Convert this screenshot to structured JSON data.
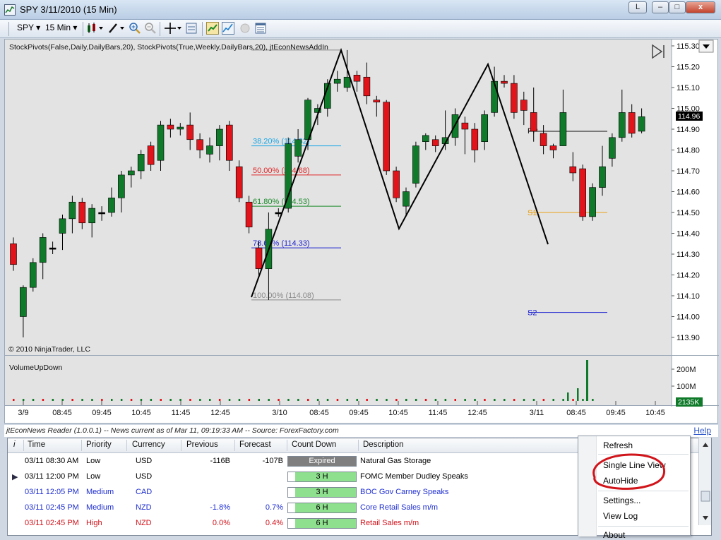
{
  "window": {
    "title": "SPY  3/11/2010 (15 Min)",
    "buttons": {
      "l": "L",
      "min": "–",
      "max": "□",
      "close": "x"
    }
  },
  "toolbar": {
    "symbol": "SPY ▾",
    "interval": "15 Min ▾"
  },
  "chart": {
    "indicator_label": "StockPivots(False,Daily,DailyBars,20), StockPivots(True,Weekly,DailyBars,20), jtEconNewsAddIn",
    "copyright": "© 2010 NinjaTrader, LLC",
    "current_price_tag": "114.96",
    "price_ticks": [
      "115.30",
      "115.20",
      "115.10",
      "115.00",
      "114.90",
      "114.80",
      "114.70",
      "114.60",
      "114.50",
      "114.40",
      "114.30",
      "114.20",
      "114.10",
      "114.00",
      "113.90"
    ],
    "fib_levels": [
      {
        "label": "38.20% (114.82)",
        "color": "#1aa6e6"
      },
      {
        "label": "50.00% (114.68)",
        "color": "#e0282a"
      },
      {
        "label": "61.80% (114.53)",
        "color": "#1b8b2a"
      },
      {
        "label": "78.60% (114.33)",
        "color": "#1b1fd0"
      },
      {
        "label": "100.00% (114.08)",
        "color": "#8a8a8a"
      }
    ],
    "pivots": {
      "pp": "PP",
      "s1": "S1",
      "s2": "S2"
    },
    "volume": {
      "label": "VolumeUpDown",
      "ticks": [
        "200M",
        "100M"
      ],
      "current_tag": "2135K"
    },
    "time_labels": [
      "3/9",
      "08:45",
      "09:45",
      "10:45",
      "11:45",
      "12:45",
      "3/10",
      "08:45",
      "09:45",
      "10:45",
      "11:45",
      "12:45",
      "3/11",
      "08:45",
      "09:45",
      "10:45"
    ]
  },
  "news": {
    "header": "jtEconNews Reader (1.0.0.1)  --  News current as of Mar 11, 09:19:33 AM  --  Source: ForexFactory.com",
    "help": "Help",
    "columns": [
      "i",
      "Time",
      "Priority",
      "Currency",
      "Previous",
      "Forecast",
      "Count Down",
      "Description"
    ],
    "rows": [
      {
        "time": "03/11 08:30 AM",
        "priority": "Low",
        "currency": "USD",
        "previous": "-116B",
        "forecast": "-107B",
        "countdown": "Expired",
        "description": "Natural Gas Storage",
        "color": "#000000"
      },
      {
        "time": "03/11 12:00 PM",
        "priority": "Low",
        "currency": "USD",
        "previous": "",
        "forecast": "",
        "countdown": "3 H",
        "description": "FOMC Member Dudley Speaks",
        "color": "#000000"
      },
      {
        "time": "03/11 12:05 PM",
        "priority": "Medium",
        "currency": "CAD",
        "previous": "",
        "forecast": "",
        "countdown": "3 H",
        "description": "BOC Gov Carney Speaks",
        "color": "#1e2ed0"
      },
      {
        "time": "03/11 02:45 PM",
        "priority": "Medium",
        "currency": "NZD",
        "previous": "-1.8%",
        "forecast": "0.7%",
        "countdown": "6 H",
        "description": "Core Retail Sales m/m",
        "color": "#1e2ed0"
      },
      {
        "time": "03/11 02:45 PM",
        "priority": "High",
        "currency": "NZD",
        "previous": "0.0%",
        "forecast": "0.4%",
        "countdown": "6 H",
        "description": "Retail Sales m/m",
        "color": "#d0121a"
      }
    ]
  },
  "context_menu": {
    "items": [
      "Refresh",
      "Single Line View",
      "AutoHide",
      "Settings...",
      "View Log",
      "About"
    ]
  }
}
